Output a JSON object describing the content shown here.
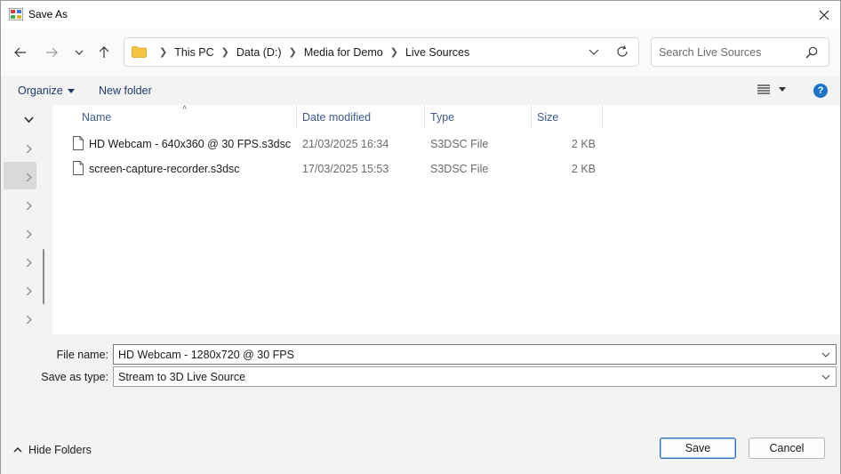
{
  "window": {
    "title": "Save As"
  },
  "address": {
    "crumbs": [
      "This PC",
      "Data (D:)",
      "Media for Demo",
      "Live Sources"
    ]
  },
  "search": {
    "placeholder": "Search Live Sources"
  },
  "toolbar": {
    "organize_label": "Organize",
    "new_folder_label": "New folder",
    "help_label": "?"
  },
  "columns": {
    "name": "Name",
    "date": "Date modified",
    "type": "Type",
    "size": "Size"
  },
  "files": [
    {
      "name": "HD Webcam - 640x360 @ 30 FPS.s3dsc",
      "date": "21/03/2025 16:34",
      "type": "S3DSC File",
      "size": "2 KB"
    },
    {
      "name": "screen-capture-recorder.s3dsc",
      "date": "17/03/2025 15:53",
      "type": "S3DSC File",
      "size": "2 KB"
    }
  ],
  "form": {
    "file_name_label": "File name:",
    "file_name_value": "HD Webcam - 1280x720 @ 30 FPS",
    "save_type_label": "Save as type:",
    "save_type_value": "Stream to 3D Live Source"
  },
  "footer": {
    "hide_folders_label": "Hide Folders",
    "save_label": "Save",
    "cancel_label": "Cancel"
  },
  "colors": {
    "accent": "#1e73c8",
    "link_text": "#1f3a68",
    "folder": "#f5c542"
  }
}
